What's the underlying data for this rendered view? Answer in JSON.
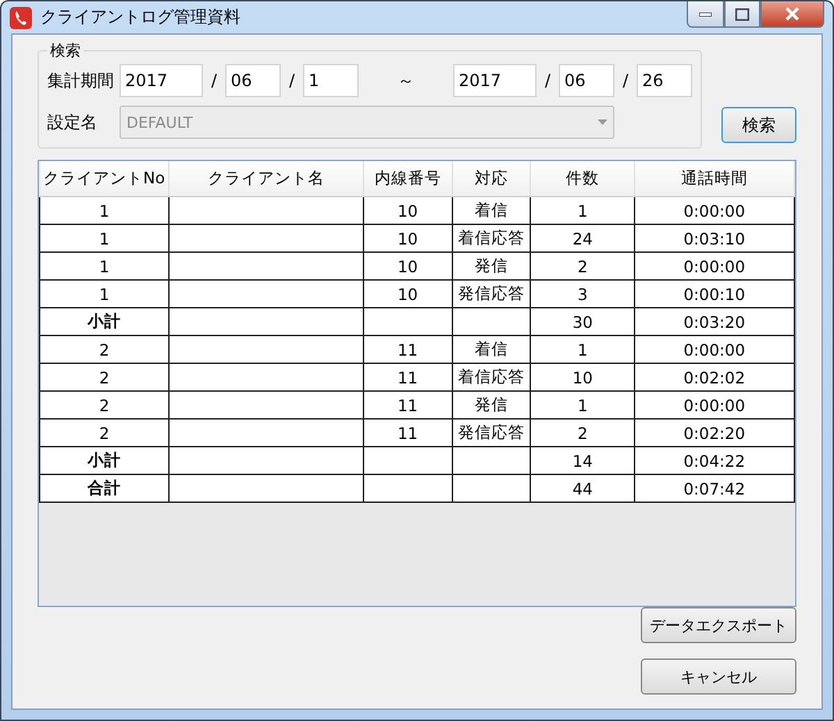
{
  "window": {
    "title": "クライアントログ管理資料"
  },
  "search": {
    "legend": "検索",
    "period_label": "集計期間",
    "from": [
      "2017",
      "06",
      "1"
    ],
    "range_sep": "～",
    "to": [
      "2017",
      "06",
      "26"
    ],
    "date_sep": "/",
    "setting_label": "設定名",
    "setting_value": "DEFAULT",
    "setting_disabled": true,
    "button": "検索"
  },
  "table": {
    "columns": [
      "クライアントNo",
      "クライアント名",
      "内線番号",
      "対応",
      "件数",
      "通話時間"
    ],
    "rows": [
      {
        "kind": "data",
        "cells": [
          "1",
          "",
          "10",
          "着信",
          "1",
          "0:00:00"
        ]
      },
      {
        "kind": "data",
        "cells": [
          "1",
          "",
          "10",
          "着信応答",
          "24",
          "0:03:10"
        ]
      },
      {
        "kind": "data",
        "cells": [
          "1",
          "",
          "10",
          "発信",
          "2",
          "0:00:00"
        ]
      },
      {
        "kind": "data",
        "cells": [
          "1",
          "",
          "10",
          "発信応答",
          "3",
          "0:00:10"
        ]
      },
      {
        "kind": "subtotal",
        "cells": [
          "小計",
          "",
          "",
          "",
          "30",
          "0:03:20"
        ]
      },
      {
        "kind": "data",
        "cells": [
          "2",
          "",
          "11",
          "着信",
          "1",
          "0:00:00"
        ]
      },
      {
        "kind": "data",
        "cells": [
          "2",
          "",
          "11",
          "着信応答",
          "10",
          "0:02:02"
        ]
      },
      {
        "kind": "data",
        "cells": [
          "2",
          "",
          "11",
          "発信",
          "1",
          "0:00:00"
        ]
      },
      {
        "kind": "data",
        "cells": [
          "2",
          "",
          "11",
          "発信応答",
          "2",
          "0:02:20"
        ]
      },
      {
        "kind": "subtotal",
        "cells": [
          "小計",
          "",
          "",
          "",
          "14",
          "0:04:22"
        ]
      },
      {
        "kind": "total",
        "cells": [
          "合計",
          "",
          "",
          "",
          "44",
          "0:07:42"
        ]
      }
    ]
  },
  "buttons": [
    "データエクスポート",
    "キャンセル"
  ]
}
